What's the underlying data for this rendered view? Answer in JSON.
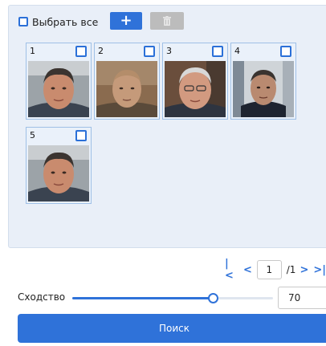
{
  "toolbar": {
    "select_all_label": "Выбрать все",
    "add_icon": "plus-icon",
    "delete_icon": "trash-icon"
  },
  "faces": [
    {
      "number": "1",
      "selected": false
    },
    {
      "number": "2",
      "selected": false
    },
    {
      "number": "3",
      "selected": false
    },
    {
      "number": "4",
      "selected": false
    },
    {
      "number": "5",
      "selected": false
    }
  ],
  "pagination": {
    "first_icon": "first-page-icon",
    "prev_icon": "prev-page-icon",
    "current_page": "1",
    "total_label": "/1",
    "next_icon": "next-page-icon",
    "last_icon": "last-page-icon"
  },
  "similarity": {
    "label": "Сходство",
    "value": "70",
    "slider_fraction": 0.7
  },
  "search_button_label": "Поиск",
  "colors": {
    "accent": "#2f72d9",
    "panel_bg": "#e9eff8",
    "card_border": "#9fc0e6",
    "disabled_button": "#bcbcbc"
  }
}
